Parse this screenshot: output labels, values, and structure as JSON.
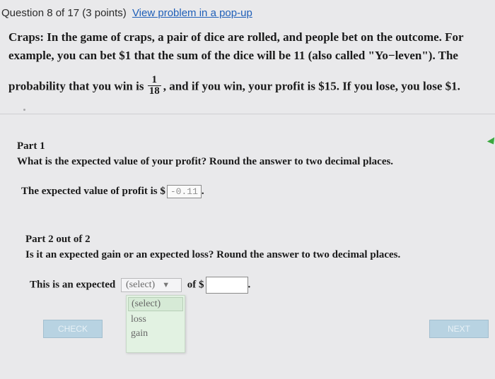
{
  "header": {
    "question_text": "Question 8 of 17 (3 points)",
    "popup_link": "View problem in a pop-up"
  },
  "problem": {
    "line1": "Craps: In the game of craps, a pair of dice are rolled, and people bet on the outcome. For example, you can bet $1 that the sum of the dice will be 11 (also called \"Yo−leven\"). The",
    "line2_before": "probability that you win is",
    "fraction_num": "1",
    "fraction_den": "18",
    "line2_after": ", and if you win, your profit is $15. If you lose, you lose $1."
  },
  "part1": {
    "title": "Part 1",
    "question": "What is the expected value of your profit? Round the answer to two decimal places.",
    "answer_prefix": "The expected value of profit is $",
    "answer_value": "-0.11",
    "answer_suffix": "."
  },
  "part2": {
    "title": "Part 2 out of 2",
    "question": "Is it an expected gain or an expected loss? Round the answer to two decimal places.",
    "answer_prefix": "This is an expected",
    "select_value": "(select)",
    "of_text": "of $",
    "answer_suffix": ".",
    "options": [
      "(select)",
      "loss",
      "gain"
    ]
  },
  "buttons": {
    "check": "CHECK",
    "next": "NEXT"
  }
}
